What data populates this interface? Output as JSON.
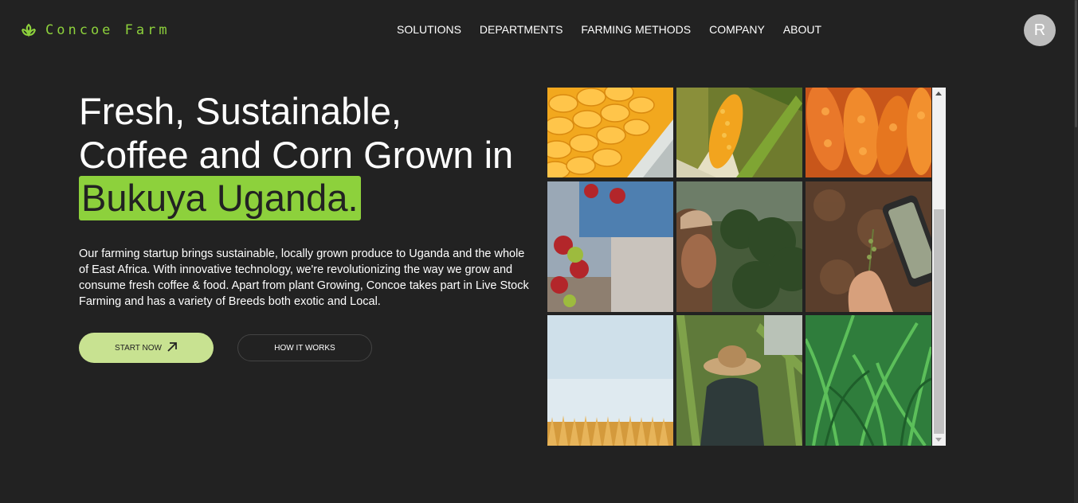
{
  "brand": {
    "name": "Concoe Farm",
    "icon": "leaf-sprout-icon",
    "color": "#8dd13c"
  },
  "nav": {
    "items": [
      {
        "label": "SOLUTIONS"
      },
      {
        "label": "DEPARTMENTS"
      },
      {
        "label": "FARMING METHODS"
      },
      {
        "label": "COMPANY"
      },
      {
        "label": "ABOUT"
      }
    ]
  },
  "user": {
    "avatar_initial": "R"
  },
  "hero": {
    "title_line1": "Fresh, Sustainable,",
    "title_line2": "Coffee and Corn Grown in",
    "title_highlight": "Bukuya Uganda.",
    "description": "Our farming startup brings sustainable, locally grown produce to Uganda and the whole of East Africa. With innovative technology, we're revolutionizing the way we grow and consume fresh coffee & food. Apart from plant Growing, Concoe takes part in Live Stock Farming and has a variety of Breeds both exotic and Local.",
    "primary_button": {
      "label": "START NOW",
      "icon": "arrow-up-right-icon"
    },
    "secondary_button": {
      "label": "HOW IT WORKS"
    }
  },
  "colors": {
    "background": "#222222",
    "accent": "#8dd13c",
    "primary_button_bg": "#c8e291"
  }
}
